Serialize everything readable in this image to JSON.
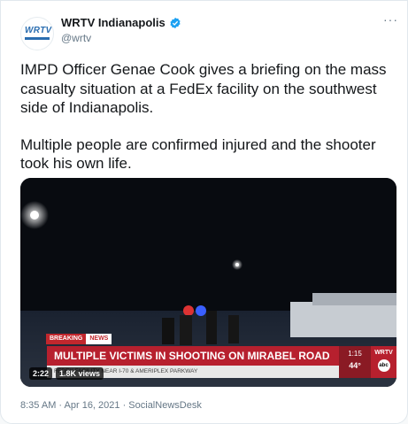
{
  "tweet": {
    "author_name": "WRTV Indianapolis",
    "handle": "@wrtv",
    "avatar_text": "WRTV",
    "more_label": "···",
    "paragraph1": "IMPD Officer Genae Cook gives a briefing on the mass casualty situation at a FedEx facility on the southwest side of Indianapolis.",
    "paragraph2": "Multiple people are confirmed injured and the shooter took his own life.",
    "timestamp": "8:35 AM · Apr 16, 2021 · SocialNewsDesk"
  },
  "video": {
    "duration": "2:22",
    "views": "1.8K views",
    "breaking_label": "BREAKING",
    "news_label": "NEWS",
    "headline": "MULTIPLE VICTIMS IN SHOOTING ON MIRABEL ROAD",
    "subline": "FEDEX FACILITY NEAR I-70 & AMERIPLEX PARKWAY",
    "clock": "1:15",
    "temperature": "44°",
    "station_logo": "WRTV",
    "network_logo": "abc"
  },
  "colors": {
    "brand_blue": "#1da1f2",
    "breaking_red": "#b7202e"
  }
}
